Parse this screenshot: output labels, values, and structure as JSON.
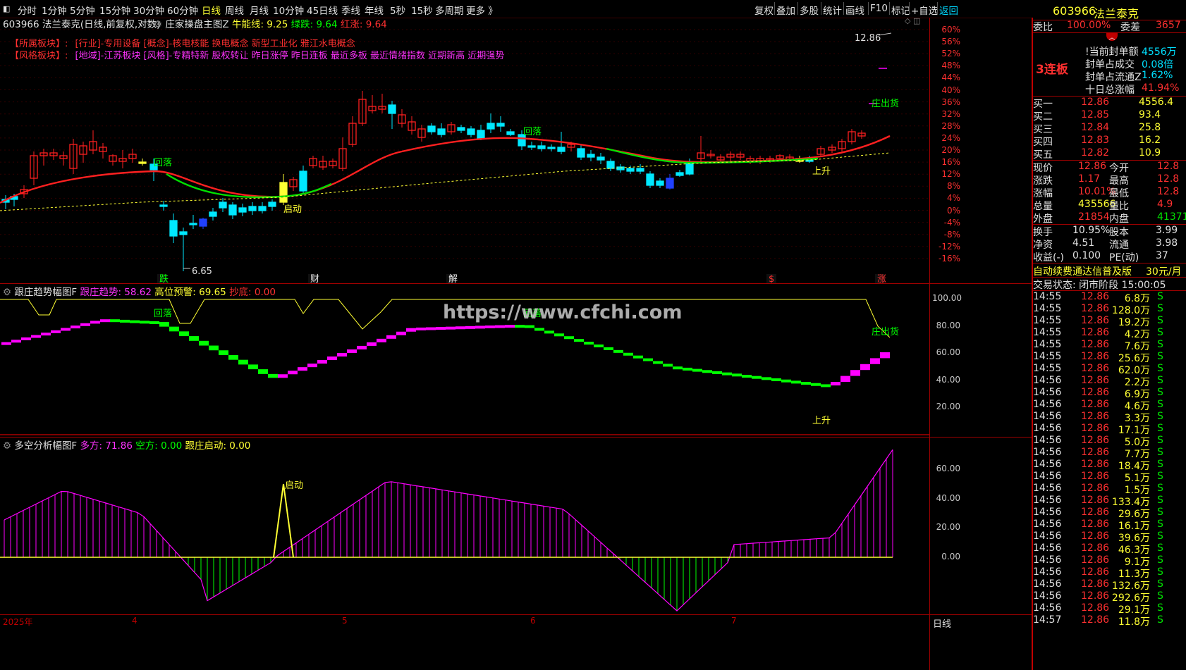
{
  "menu": {
    "items": [
      "分时",
      "1分钟",
      "5分钟",
      "15分钟",
      "30分钟",
      "60分钟",
      "日线",
      "周线",
      "月线",
      "10分钟",
      "45日线",
      "季线",
      "年线",
      "5秒",
      "15秒",
      "多周期",
      "更多 》"
    ],
    "active_index": 6,
    "right_buttons": [
      "复权",
      "叠加",
      "多股",
      "统计",
      "画线",
      "F10",
      "标记",
      "+自选",
      "返回"
    ]
  },
  "main_chart": {
    "stock_title": "603966 法兰泰克(日线,前复权,对数)",
    "indicator_name": "庄家操盘主图Z",
    "indicator_values": {
      "牛能线": "牛能线: 9.25",
      "绿跌": "绿跌: 9.64",
      "红涨": "红涨: 9.64"
    },
    "sector_label": "【所属板块】:",
    "sector_text": "[行业]-专用设备 [概念]-核电核能 换电概念 新型工业化 雅江水电概念",
    "style_label": "【风格板块】:",
    "style_text": "[地域]-江苏板块 [风格]-专精特新 股权转让 昨日涨停 昨日连板 最近多板 最近情绪指数 近期新高 近期强势",
    "pct_ticks": [
      "60%",
      "56%",
      "52%",
      "48%",
      "44%",
      "40%",
      "36%",
      "32%",
      "28%",
      "24%",
      "20%",
      "16%",
      "12%",
      "8%",
      "4%",
      "0%",
      "-4%",
      "-8%",
      "-12%",
      "-16%"
    ],
    "high_label": "12.86",
    "low_label": "6.65",
    "annotations": [
      "回落",
      "启动",
      "回落",
      "庄出货",
      "上升"
    ],
    "event_markers": [
      "跌",
      "财",
      "解",
      "$",
      "涨"
    ]
  },
  "panel2": {
    "title": "跟庄趋势幅图F",
    "values": {
      "跟庄趋势": "跟庄趋势: 58.62",
      "高位预警": "高位预警: 69.65",
      "抄底": "抄底: 0.00"
    },
    "ticks": [
      "100.00",
      "80.00",
      "60.00",
      "40.00",
      "20.00"
    ],
    "annotations": [
      "回落",
      "回落",
      "庄出货",
      "上升"
    ],
    "watermark": "https://www.cfchi.com"
  },
  "panel3": {
    "title": "多空分析幅图F",
    "values": {
      "多方": "多方: 71.86",
      "空方": "空方: 0.00",
      "跟庄启动": "跟庄启动: 0.00"
    },
    "ticks": [
      "60.00",
      "40.00",
      "20.00",
      "0.00"
    ],
    "annotation": "启动"
  },
  "time_axis": {
    "labels": [
      "2025年",
      "4",
      "5",
      "6",
      "7"
    ],
    "period_label": "日线"
  },
  "quote_panel": {
    "code": "603966",
    "name": "法兰泰克",
    "weibi_label": "委比",
    "weibi_value": "100.00%",
    "weicha_label": "委差",
    "weicha_value": "3657",
    "board_tag": "3连板",
    "seal_rows": [
      {
        "label": "!当前封单额",
        "value": "4556万"
      },
      {
        "label": "封单占成交",
        "value": "0.08倍"
      },
      {
        "label": "封单占流通Z",
        "value": "1.62%"
      },
      {
        "label": "十日总涨幅",
        "value": "41.94%"
      }
    ],
    "bids": [
      {
        "label": "买一",
        "price": "12.86",
        "vol": "4556.4"
      },
      {
        "label": "买二",
        "price": "12.85",
        "vol": "93.4"
      },
      {
        "label": "买三",
        "price": "12.84",
        "vol": "25.8"
      },
      {
        "label": "买四",
        "price": "12.83",
        "vol": "16.2"
      },
      {
        "label": "买五",
        "price": "12.82",
        "vol": "10.9"
      }
    ],
    "stats": [
      {
        "l1": "现价",
        "v1": "12.86",
        "l2": "今开",
        "v2": "12.8"
      },
      {
        "l1": "涨跌",
        "v1": "1.17",
        "l2": "最高",
        "v2": "12.8"
      },
      {
        "l1": "涨幅",
        "v1": "10.01%",
        "l2": "最低",
        "v2": "12.8"
      },
      {
        "l1": "总量",
        "v1": "435566",
        "l2": "量比",
        "v2": "4.9"
      },
      {
        "l1": "外盘",
        "v1": "21854",
        "l2": "内盘",
        "v2": "41371"
      }
    ],
    "stats2": [
      {
        "l1": "换手",
        "v1": "10.95%",
        "l2": "股本",
        "v2": "3.99"
      },
      {
        "l1": "净资",
        "v1": "4.51",
        "l2": "流通",
        "v2": "3.98"
      },
      {
        "l1": "收益(-)",
        "v1": "0.100",
        "l2": "PE(动)",
        "v2": "37"
      }
    ],
    "ad_text": "自动续费通达信普及版",
    "ad_price": "30元/月",
    "status_text": "交易状态: 闭市阶段 15:00:05",
    "trades": [
      [
        "14:55",
        "12.86",
        "6.8万",
        "S"
      ],
      [
        "14:55",
        "12.86",
        "128.0万",
        "S"
      ],
      [
        "14:55",
        "12.86",
        "19.2万",
        "S"
      ],
      [
        "14:55",
        "12.86",
        "4.2万",
        "S"
      ],
      [
        "14:55",
        "12.86",
        "7.6万",
        "S"
      ],
      [
        "14:55",
        "12.86",
        "25.6万",
        "S"
      ],
      [
        "14:55",
        "12.86",
        "62.0万",
        "S"
      ],
      [
        "14:56",
        "12.86",
        "2.2万",
        "S"
      ],
      [
        "14:56",
        "12.86",
        "6.9万",
        "S"
      ],
      [
        "14:56",
        "12.86",
        "4.6万",
        "S"
      ],
      [
        "14:56",
        "12.86",
        "3.3万",
        "S"
      ],
      [
        "14:56",
        "12.86",
        "17.1万",
        "S"
      ],
      [
        "14:56",
        "12.86",
        "5.0万",
        "S"
      ],
      [
        "14:56",
        "12.86",
        "7.7万",
        "S"
      ],
      [
        "14:56",
        "12.86",
        "18.4万",
        "S"
      ],
      [
        "14:56",
        "12.86",
        "5.1万",
        "S"
      ],
      [
        "14:56",
        "12.86",
        "1.5万",
        "S"
      ],
      [
        "14:56",
        "12.86",
        "133.4万",
        "S"
      ],
      [
        "14:56",
        "12.86",
        "29.6万",
        "S"
      ],
      [
        "14:56",
        "12.86",
        "16.1万",
        "S"
      ],
      [
        "14:56",
        "12.86",
        "39.6万",
        "S"
      ],
      [
        "14:56",
        "12.86",
        "46.3万",
        "S"
      ],
      [
        "14:56",
        "12.86",
        "9.1万",
        "S"
      ],
      [
        "14:56",
        "12.86",
        "11.3万",
        "S"
      ],
      [
        "14:56",
        "12.86",
        "132.6万",
        "S"
      ],
      [
        "14:56",
        "12.86",
        "292.6万",
        "S"
      ],
      [
        "14:56",
        "12.86",
        "29.1万",
        "S"
      ],
      [
        "14:57",
        "12.86",
        "11.8万",
        "S"
      ]
    ]
  },
  "colors": {
    "up": "#ff2020",
    "down": "#00e8ff",
    "accent": "#ffff33",
    "magenta": "#ff00ff",
    "green": "#00ff00",
    "grid": "#a00000"
  }
}
